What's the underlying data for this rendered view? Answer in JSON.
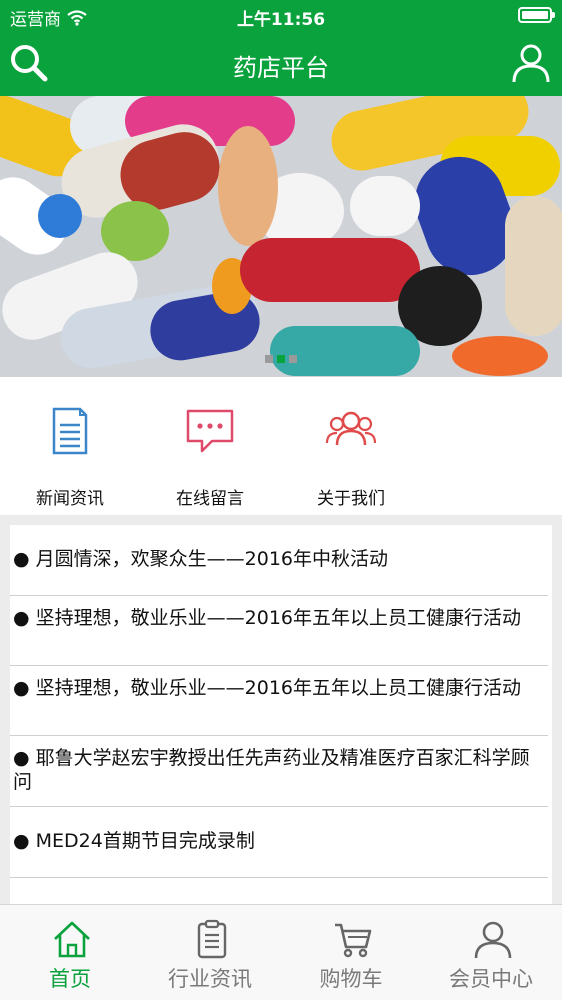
{
  "status_bar": {
    "carrier": "运营商",
    "time": "上午11:56",
    "battery_level": 1.0
  },
  "navbar": {
    "title": "药店平台",
    "search_icon": "search-icon",
    "user_icon": "user-icon"
  },
  "banner": {
    "dots": 3,
    "active_dot": 1
  },
  "quick_links": [
    {
      "label": "新闻资讯",
      "icon": "document-icon",
      "color": "#3a86c8"
    },
    {
      "label": "在线留言",
      "icon": "message-bubble-icon",
      "color": "#e04a6a"
    },
    {
      "label": "关于我们",
      "icon": "people-icon",
      "color": "#e04a4a"
    }
  ],
  "news": {
    "bullet": "●",
    "items": [
      "月圆情深，欢聚众生——2016年中秋活动",
      "坚持理想，敬业乐业——2016年五年以上员工健康行活动",
      "坚持理想，敬业乐业——2016年五年以上员工健康行活动",
      "耶鲁大学赵宏宇教授出任先声药业及精准医疗百家汇科学顾问",
      "MED24首期节目完成录制"
    ]
  },
  "tabbar": {
    "accent": "#0aa23c",
    "tabs": [
      {
        "label": "首页",
        "icon": "home-icon",
        "active": true
      },
      {
        "label": "行业资讯",
        "icon": "clipboard-icon",
        "active": false
      },
      {
        "label": "购物车",
        "icon": "cart-icon",
        "active": false
      },
      {
        "label": "会员中心",
        "icon": "member-icon",
        "active": false
      }
    ]
  }
}
